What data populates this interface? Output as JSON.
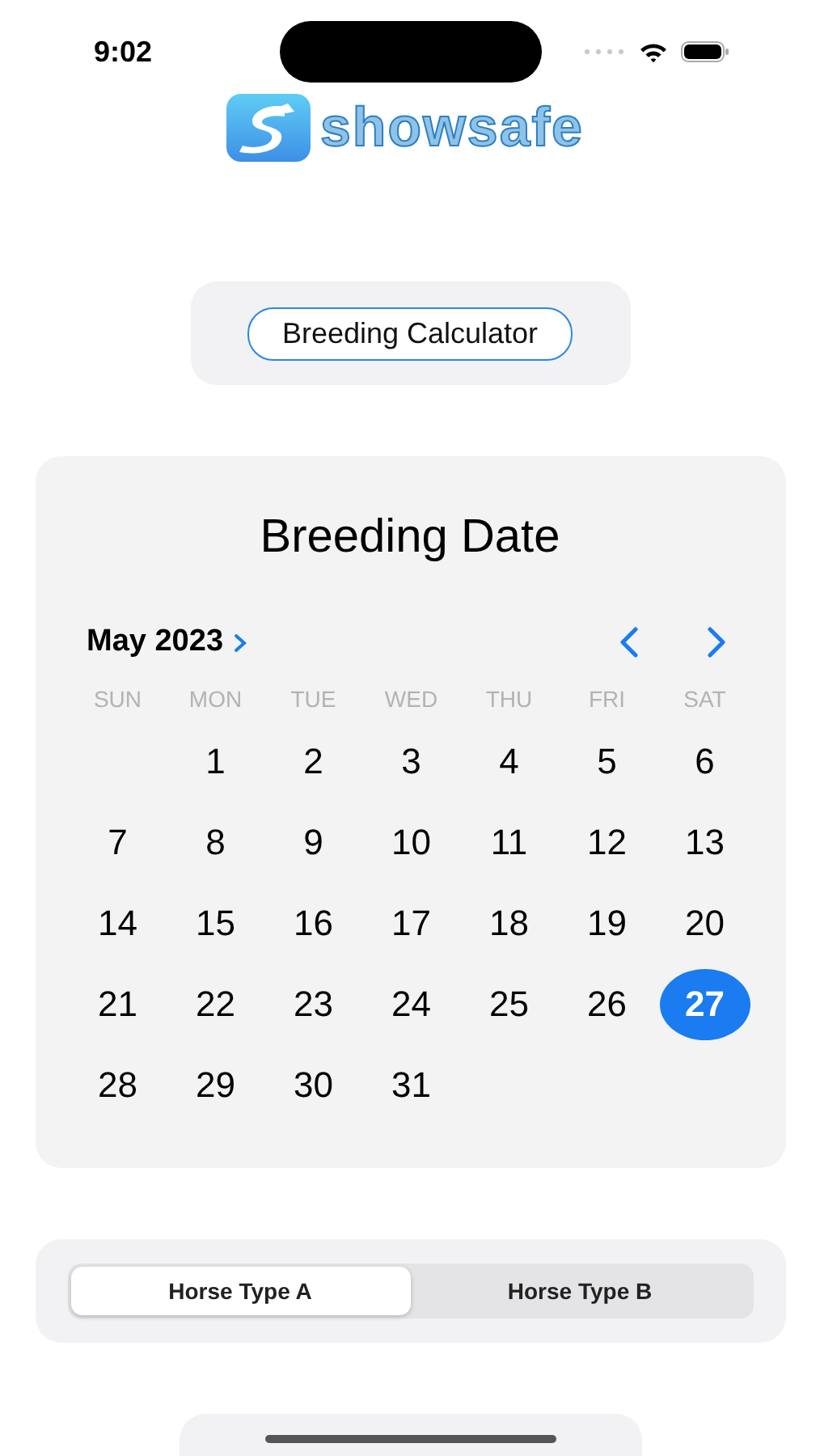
{
  "status_bar": {
    "time": "9:02"
  },
  "logo": {
    "text": "showsafe"
  },
  "calculator_button": {
    "label": "Breeding Calculator"
  },
  "calendar": {
    "title": "Breeding Date",
    "month": "May 2023",
    "weekdays": [
      "SUN",
      "MON",
      "TUE",
      "WED",
      "THU",
      "FRI",
      "SAT"
    ],
    "weeks": [
      {
        "days": [
          {
            "label": "1",
            "selected": false
          },
          {
            "label": "2",
            "selected": false
          },
          {
            "label": "3",
            "selected": false
          },
          {
            "label": "4",
            "selected": false
          },
          {
            "label": "5",
            "selected": false
          },
          {
            "label": "6",
            "selected": false
          }
        ]
      },
      {
        "days": [
          {
            "label": "7",
            "selected": false
          },
          {
            "label": "8",
            "selected": false
          },
          {
            "label": "9",
            "selected": false
          },
          {
            "label": "10",
            "selected": false
          },
          {
            "label": "11",
            "selected": false
          },
          {
            "label": "12",
            "selected": false
          },
          {
            "label": "13",
            "selected": false
          }
        ]
      },
      {
        "days": [
          {
            "label": "14",
            "selected": false
          },
          {
            "label": "15",
            "selected": false
          },
          {
            "label": "16",
            "selected": false
          },
          {
            "label": "17",
            "selected": false
          },
          {
            "label": "18",
            "selected": false
          },
          {
            "label": "19",
            "selected": false
          },
          {
            "label": "20",
            "selected": false
          }
        ]
      },
      {
        "days": [
          {
            "label": "21",
            "selected": false
          },
          {
            "label": "22",
            "selected": false
          },
          {
            "label": "23",
            "selected": false
          },
          {
            "label": "24",
            "selected": false
          },
          {
            "label": "25",
            "selected": false
          },
          {
            "label": "26",
            "selected": false
          },
          {
            "label": "27",
            "selected": true
          }
        ]
      },
      {
        "days": [
          {
            "label": "28",
            "selected": false
          },
          {
            "label": "29",
            "selected": false
          },
          {
            "label": "30",
            "selected": false
          },
          {
            "label": "31",
            "selected": false
          }
        ]
      }
    ]
  },
  "segments": [
    {
      "label": "Horse Type A",
      "selected": true
    },
    {
      "label": "Horse Type B",
      "selected": false
    }
  ]
}
